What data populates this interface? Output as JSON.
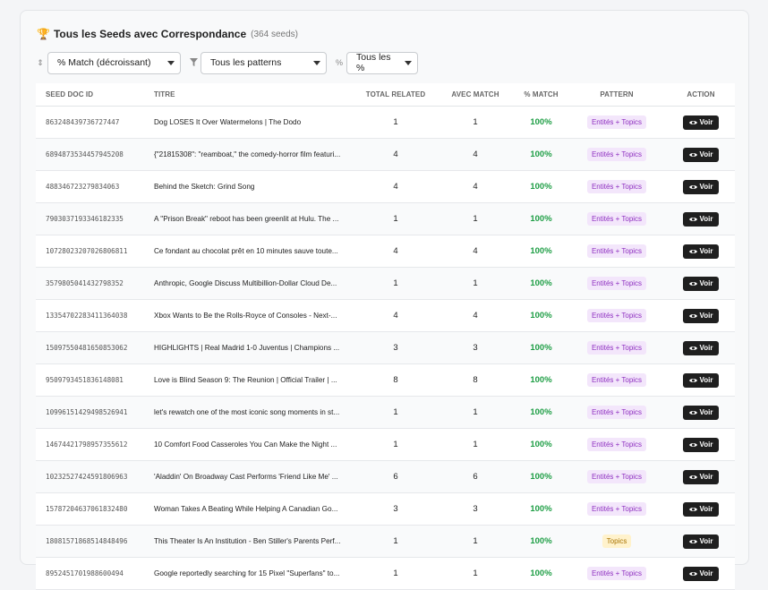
{
  "header": {
    "icon": "trophy-icon",
    "title": "Tous les Seeds avec Correspondance",
    "count": "(364 seeds)"
  },
  "filters": {
    "sort": {
      "icon": "sort-icon",
      "value": "% Match (décroissant)"
    },
    "pattern": {
      "icon": "filter-icon",
      "value": "Tous les patterns"
    },
    "percent": {
      "icon": "percent-icon",
      "value": "Tous les %"
    }
  },
  "table": {
    "columns": [
      "SEED DOC ID",
      "TITRE",
      "TOTAL RELATED",
      "AVEC MATCH",
      "% MATCH",
      "PATTERN",
      "ACTION"
    ],
    "rows": [
      {
        "id": "863248439736727447",
        "title": "Dog LOSES It Over Watermelons | The Dodo",
        "total": "1",
        "match": "1",
        "pct": "100%",
        "pattern": "Entités + Topics",
        "action": "Voir"
      },
      {
        "id": "6894873534457945208",
        "title": "{\"21815308\": \"reamboat,\" the comedy-horror film featuri...",
        "total": "4",
        "match": "4",
        "pct": "100%",
        "pattern": "Entités + Topics",
        "action": "Voir"
      },
      {
        "id": "488346723279834063",
        "title": "Behind the Sketch: Grind Song",
        "total": "4",
        "match": "4",
        "pct": "100%",
        "pattern": "Entités + Topics",
        "action": "Voir"
      },
      {
        "id": "7903037193346182335",
        "title": "A \"Prison Break\" reboot has been greenlit at Hulu. The ...",
        "total": "1",
        "match": "1",
        "pct": "100%",
        "pattern": "Entités + Topics",
        "action": "Voir"
      },
      {
        "id": "10728023207026806811",
        "title": "Ce fondant au chocolat prêt en 10 minutes sauve toute...",
        "total": "4",
        "match": "4",
        "pct": "100%",
        "pattern": "Entités + Topics",
        "action": "Voir"
      },
      {
        "id": "3579805041432798352",
        "title": "Anthropic, Google Discuss Multibillion-Dollar Cloud De...",
        "total": "1",
        "match": "1",
        "pct": "100%",
        "pattern": "Entités + Topics",
        "action": "Voir"
      },
      {
        "id": "13354702283411364038",
        "title": "Xbox Wants to Be the Rolls-Royce of Consoles - Next-...",
        "total": "4",
        "match": "4",
        "pct": "100%",
        "pattern": "Entités + Topics",
        "action": "Voir"
      },
      {
        "id": "15097550481650853062",
        "title": "HIGHLIGHTS | Real Madrid 1-0 Juventus | Champions ...",
        "total": "3",
        "match": "3",
        "pct": "100%",
        "pattern": "Entités + Topics",
        "action": "Voir"
      },
      {
        "id": "9509793451836148081",
        "title": "Love is Blind Season 9: The Reunion | Official Trailer | ...",
        "total": "8",
        "match": "8",
        "pct": "100%",
        "pattern": "Entités + Topics",
        "action": "Voir"
      },
      {
        "id": "10996151429498526941",
        "title": "let's rewatch one of the most iconic song moments in st...",
        "total": "1",
        "match": "1",
        "pct": "100%",
        "pattern": "Entités + Topics",
        "action": "Voir"
      },
      {
        "id": "14674421798957355612",
        "title": "10 Comfort Food Casseroles You Can Make the Night ...",
        "total": "1",
        "match": "1",
        "pct": "100%",
        "pattern": "Entités + Topics",
        "action": "Voir"
      },
      {
        "id": "10232527424591806963",
        "title": "'Aladdin' On Broadway Cast Performs 'Friend Like Me' ...",
        "total": "6",
        "match": "6",
        "pct": "100%",
        "pattern": "Entités + Topics",
        "action": "Voir"
      },
      {
        "id": "15787204637061832480",
        "title": "Woman Takes A Beating While Helping A Canadian Go...",
        "total": "3",
        "match": "3",
        "pct": "100%",
        "pattern": "Entités + Topics",
        "action": "Voir"
      },
      {
        "id": "18081571868514848496",
        "title": "This Theater Is An Institution - Ben Stiller's Parents Perf...",
        "total": "1",
        "match": "1",
        "pct": "100%",
        "pattern": "Topics",
        "action": "Voir"
      },
      {
        "id": "8952451701988600494",
        "title": "Google reportedly searching for 15 Pixel \"Superfans\" to...",
        "total": "1",
        "match": "1",
        "pct": "100%",
        "pattern": "Entités + Topics",
        "action": "Voir"
      }
    ]
  }
}
